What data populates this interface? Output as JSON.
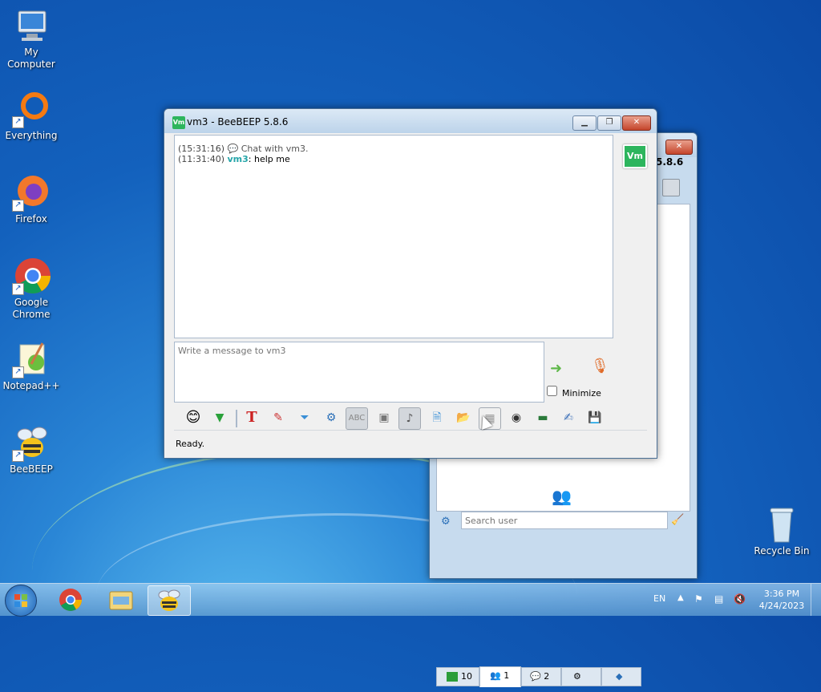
{
  "desktop": {
    "icons": [
      {
        "label": "My Computer"
      },
      {
        "label": "Everything"
      },
      {
        "label": "Firefox"
      },
      {
        "label": "Google Chrome"
      },
      {
        "label": "Notepad++"
      },
      {
        "label": "BeeBEEP"
      },
      {
        "label": "Recycle Bin"
      }
    ]
  },
  "chat_window": {
    "title": "vm3 - BeeBEEP 5.8.6",
    "badge": "Vm",
    "messages": [
      {
        "time": "(15:31:16)",
        "text": "Chat with vm3."
      },
      {
        "time": "(11:31:40)",
        "user": "vm3",
        "text": ": help me"
      }
    ],
    "input_placeholder": "Write a message to vm3",
    "minimize_label": "Minimize",
    "status": "Ready."
  },
  "main_window": {
    "title_fragment": "5.8.6",
    "search_placeholder": "Search user",
    "tabs": [
      {
        "icon": "monitor-icon",
        "count": "10"
      },
      {
        "icon": "users-icon",
        "count": "1"
      },
      {
        "icon": "chat-bubbles-icon",
        "count": "2"
      },
      {
        "icon": "group-icon",
        "count": ""
      },
      {
        "icon": "share-icon",
        "count": ""
      }
    ]
  },
  "taskbar": {
    "language": "EN",
    "time": "3:36 PM",
    "date": "4/24/2023"
  }
}
